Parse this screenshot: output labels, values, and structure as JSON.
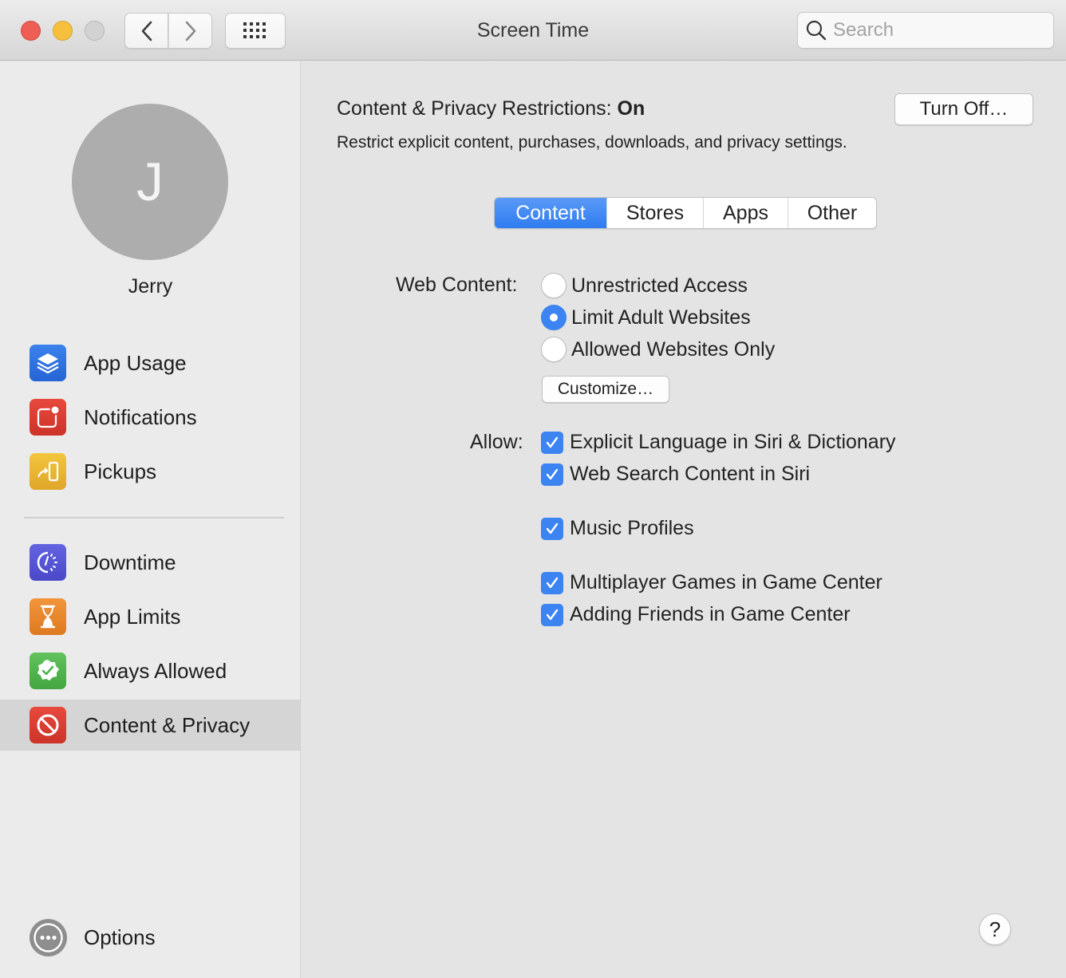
{
  "window": {
    "title": "Screen Time",
    "traffic_lights": [
      "close",
      "minimize",
      "zoom"
    ],
    "toolbar": {
      "back_icon": "chevron-left-icon",
      "forward_icon": "chevron-right-icon",
      "grid_icon": "show-all-grid-icon"
    },
    "search": {
      "placeholder": "Search",
      "value": "",
      "icon": "search-icon"
    }
  },
  "sidebar": {
    "user": {
      "initial": "J",
      "name": "Jerry"
    },
    "items": [
      {
        "label": "App Usage",
        "icon": "layers-icon",
        "color": "#2e6fdc"
      },
      {
        "label": "Notifications",
        "icon": "notification-badge-icon",
        "color": "#dc3d32"
      },
      {
        "label": "Pickups",
        "icon": "pickup-phone-icon",
        "color": "#e9b52e"
      },
      {
        "label": "Downtime",
        "icon": "downtime-clock-icon",
        "color": "#5554d4"
      },
      {
        "label": "App Limits",
        "icon": "hourglass-icon",
        "color": "#e98427"
      },
      {
        "label": "Always Allowed",
        "icon": "checkmark-seal-icon",
        "color": "#4fb34d"
      },
      {
        "label": "Content & Privacy",
        "icon": "prohibited-icon",
        "color": "#dc3d32",
        "selected": true
      }
    ],
    "options": {
      "label": "Options",
      "icon": "ellipsis-circle-icon"
    }
  },
  "main": {
    "status_prefix": "Content & Privacy Restrictions: ",
    "status_value": "On",
    "turn_off_label": "Turn Off…",
    "description": "Restrict explicit content, purchases, downloads, and privacy settings.",
    "tabs": [
      {
        "label": "Content",
        "active": true
      },
      {
        "label": "Stores",
        "active": false
      },
      {
        "label": "Apps",
        "active": false
      },
      {
        "label": "Other",
        "active": false
      }
    ],
    "web_content": {
      "label": "Web Content:",
      "options": [
        {
          "label": "Unrestricted Access",
          "selected": false
        },
        {
          "label": "Limit Adult Websites",
          "selected": true
        },
        {
          "label": "Allowed Websites Only",
          "selected": false
        }
      ],
      "customize_label": "Customize…"
    },
    "allow": {
      "label": "Allow:",
      "items": [
        {
          "label": "Explicit Language in Siri & Dictionary",
          "checked": true
        },
        {
          "label": "Web Search Content in Siri",
          "checked": true
        },
        {
          "label": "Music Profiles",
          "checked": true
        },
        {
          "label": "Multiplayer Games in Game Center",
          "checked": true
        },
        {
          "label": "Adding Friends in Game Center",
          "checked": true
        }
      ]
    },
    "help_label": "?"
  },
  "colors": {
    "accent": "#3b84f2",
    "selected_row": "#d5d5d5"
  }
}
